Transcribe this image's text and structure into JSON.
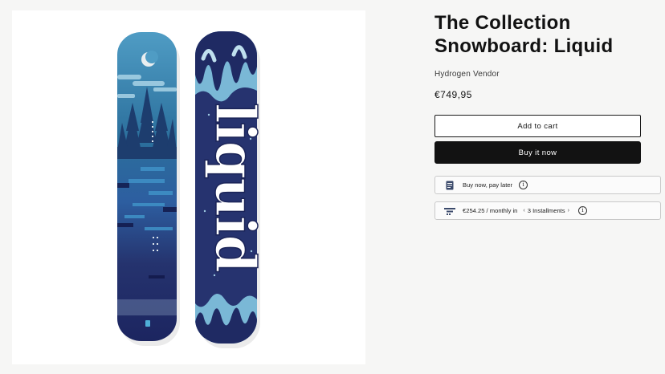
{
  "product": {
    "title": "The Collection Snowboard: Liquid",
    "vendor": "Hydrogen Vendor",
    "price": "€749,95"
  },
  "buttons": {
    "add_to_cart": "Add to cart",
    "buy_it_now": "Buy it now"
  },
  "payment": {
    "pay_later_label": "Buy now, pay later",
    "installment_amount": "€254.25 / monthly in",
    "installment_count": "3 Installments",
    "info_glyph": "i",
    "chevron_left": "‹",
    "chevron_right": "›",
    "pay_later_icon": "document-icon",
    "installment_icon": "installment-icon"
  },
  "image": {
    "board_lettering": "liquid"
  },
  "colors": {
    "text": "#121212",
    "background": "#f6f6f5",
    "buy_button_bg": "#121212",
    "board_navy": "#1f2a63",
    "board_light_blue": "#7ab8d6"
  }
}
